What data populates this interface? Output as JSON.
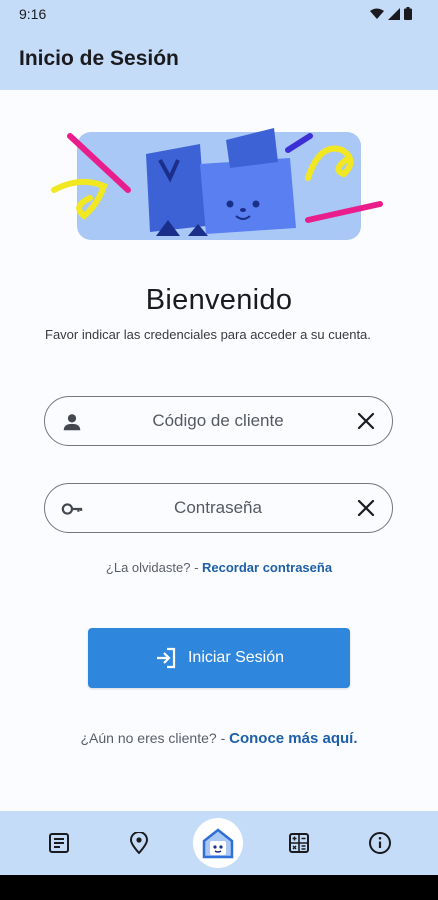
{
  "status": {
    "time": "9:16"
  },
  "appbar": {
    "title": "Inicio de Sesión"
  },
  "hero": {
    "icon": "mascot-illustration"
  },
  "welcome": {
    "title": "Bienvenido",
    "subtitle": "Favor indicar las credenciales para acceder a su cuenta."
  },
  "form": {
    "client_placeholder": "Código de cliente",
    "client_value": "",
    "password_placeholder": "Contraseña",
    "password_value": "",
    "forgot_text": "¿La olvidaste? - ",
    "forgot_link": "Recordar contraseña",
    "login_label": "Iniciar Sesión"
  },
  "signup": {
    "text": "¿Aún no eres cliente? - ",
    "link": "Conoce más aquí."
  },
  "nav": {
    "items": [
      {
        "icon": "document-icon"
      },
      {
        "icon": "location-pin-icon"
      },
      {
        "icon": "home-mascot-icon"
      },
      {
        "icon": "calculator-icon"
      },
      {
        "icon": "info-icon"
      }
    ]
  },
  "colors": {
    "bar": "#c4dcf8",
    "primary": "#2f86dd",
    "link": "#1d5fa8"
  }
}
